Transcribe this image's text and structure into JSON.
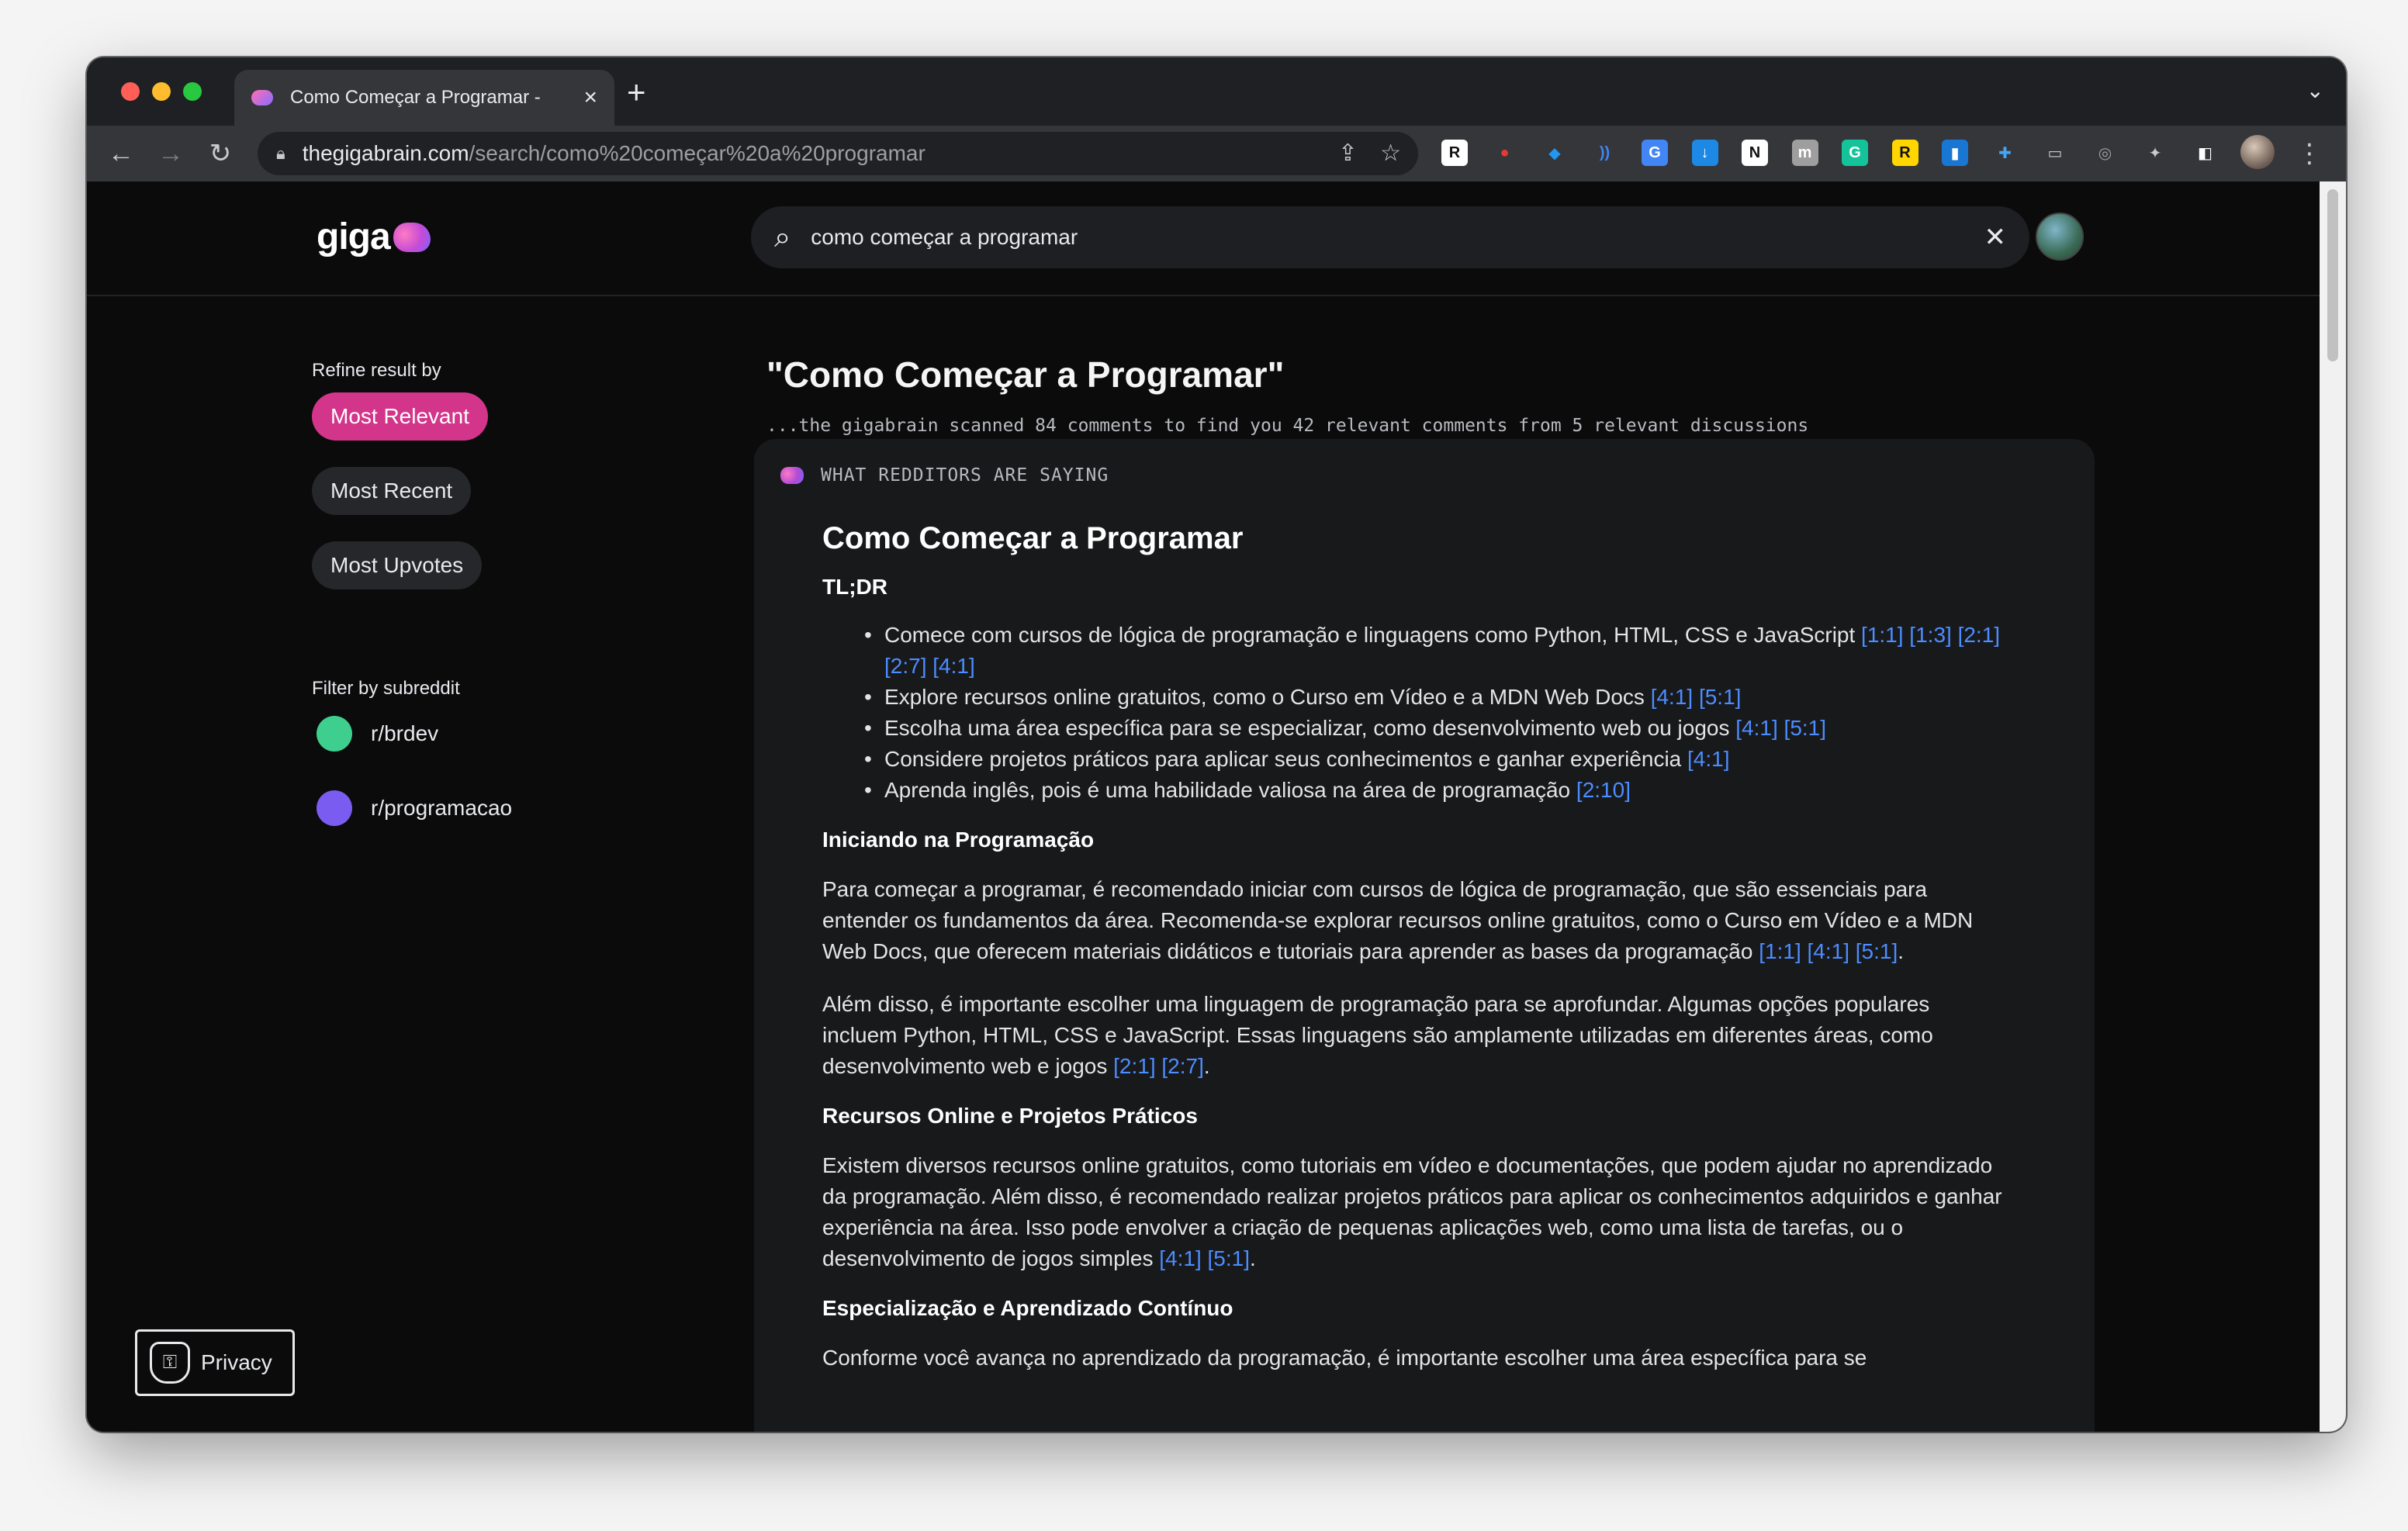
{
  "browser": {
    "tab_title": "Como Começar a Programar - ",
    "url_domain": "thegigabrain.com",
    "url_path": "/search/como%20começar%20a%20programar"
  },
  "app": {
    "logo_text": "giga",
    "search_query": "como começar a programar"
  },
  "sidebar": {
    "refine_label": "Refine result by",
    "sort_options": [
      "Most Relevant",
      "Most Recent",
      "Most Upvotes"
    ],
    "filter_label": "Filter by subreddit",
    "subreddits": [
      {
        "name": "r/brdev",
        "color": "#3ecf8e"
      },
      {
        "name": "r/programacao",
        "color": "#7b5cf0"
      }
    ],
    "privacy_label": "Privacy"
  },
  "main": {
    "title": "\"Como Começar a Programar\"",
    "scan_summary": "...the gigabrain scanned 84 comments to find you 42 relevant comments from 5 relevant discussions",
    "card": {
      "kicker": "WHAT REDDITORS ARE SAYING",
      "title": "Como Começar a Programar",
      "tldr_label": "TL;DR",
      "tldr": [
        {
          "text": "Comece com cursos de lógica de programação e linguagens como Python, HTML, CSS e JavaScript",
          "cites": "[1:1] [1:3] [2:1] [2:7] [4:1]"
        },
        {
          "text": "Explore recursos online gratuitos, como o Curso em Vídeo e a MDN Web Docs",
          "cites": "[4:1] [5:1]"
        },
        {
          "text": "Escolha uma área específica para se especializar, como desenvolvimento web ou jogos",
          "cites": "[4:1] [5:1]"
        },
        {
          "text": "Considere projetos práticos para aplicar seus conhecimentos e ganhar experiência",
          "cites": "[4:1]"
        },
        {
          "text": "Aprenda inglês, pois é uma habilidade valiosa na área de programação",
          "cites": "[2:10]"
        }
      ],
      "sections": [
        {
          "heading": "Iniciando na Programação",
          "paragraphs": [
            {
              "text": "Para começar a programar, é recomendado iniciar com cursos de lógica de programação, que são essenciais para entender os fundamentos da área. Recomenda-se explorar recursos online gratuitos, como o Curso em Vídeo e a MDN Web Docs, que oferecem materiais didáticos e tutoriais para aprender as bases da programação",
              "cites": "[1:1] [4:1] [5:1]",
              "end": "."
            },
            {
              "text": "Além disso, é importante escolher uma linguagem de programação para se aprofundar. Algumas opções populares incluem Python, HTML, CSS e JavaScript. Essas linguagens são amplamente utilizadas em diferentes áreas, como desenvolvimento web e jogos",
              "cites": "[2:1] [2:7]",
              "end": "."
            }
          ]
        },
        {
          "heading": "Recursos Online e Projetos Práticos",
          "paragraphs": [
            {
              "text": "Existem diversos recursos online gratuitos, como tutoriais em vídeo e documentações, que podem ajudar no aprendizado da programação. Além disso, é recomendado realizar projetos práticos para aplicar os conhecimentos adquiridos e ganhar experiência na área. Isso pode envolver a criação de pequenas aplicações web, como uma lista de tarefas, ou o desenvolvimento de jogos simples",
              "cites": "[4:1] [5:1]",
              "end": "."
            }
          ]
        },
        {
          "heading": "Especialização e Aprendizado Contínuo",
          "paragraphs": [
            {
              "text": "Conforme você avança no aprendizado da programação, é importante escolher uma área específica para se",
              "cites": "",
              "end": ""
            }
          ]
        }
      ]
    }
  },
  "extensions": [
    {
      "icon": "readwise-icon",
      "glyph": "R",
      "bg": "#ffffff",
      "fg": "#111111"
    },
    {
      "icon": "pokeball-icon",
      "glyph": "●",
      "bg": "transparent",
      "fg": "#e53935"
    },
    {
      "icon": "diamond-icon",
      "glyph": "◆",
      "bg": "transparent",
      "fg": "#2196f3"
    },
    {
      "icon": "speech-icon",
      "glyph": "))",
      "bg": "transparent",
      "fg": "#4285f4"
    },
    {
      "icon": "translate-icon",
      "glyph": "G",
      "bg": "#4285f4",
      "fg": "#ffffff"
    },
    {
      "icon": "download-icon",
      "glyph": "↓",
      "bg": "#1e88e5",
      "fg": "#ffffff"
    },
    {
      "icon": "notion-icon",
      "glyph": "N",
      "bg": "#ffffff",
      "fg": "#111111"
    },
    {
      "icon": "mastodon-icon",
      "glyph": "m",
      "bg": "#9e9e9e",
      "fg": "#ffffff"
    },
    {
      "icon": "grammarly-icon",
      "glyph": "G",
      "bg": "#15c39a",
      "fg": "#ffffff"
    },
    {
      "icon": "r-extension-icon",
      "glyph": "R",
      "bg": "#ffd600",
      "fg": "#111111"
    },
    {
      "icon": "bookmark-icon",
      "glyph": "▮",
      "bg": "#1976d2",
      "fg": "#ffffff"
    },
    {
      "icon": "settings-ext-icon",
      "glyph": "✚",
      "bg": "transparent",
      "fg": "#42a5f5"
    },
    {
      "icon": "window-ext-icon",
      "glyph": "▭",
      "bg": "transparent",
      "fg": "#c8cacf"
    },
    {
      "icon": "screenshot-icon",
      "glyph": "◎",
      "bg": "transparent",
      "fg": "#9aa0a6"
    },
    {
      "icon": "puzzle-icon",
      "glyph": "✦",
      "bg": "transparent",
      "fg": "#c8cacf"
    },
    {
      "icon": "sidepanel-icon",
      "glyph": "◧",
      "bg": "transparent",
      "fg": "#ffffff"
    }
  ]
}
